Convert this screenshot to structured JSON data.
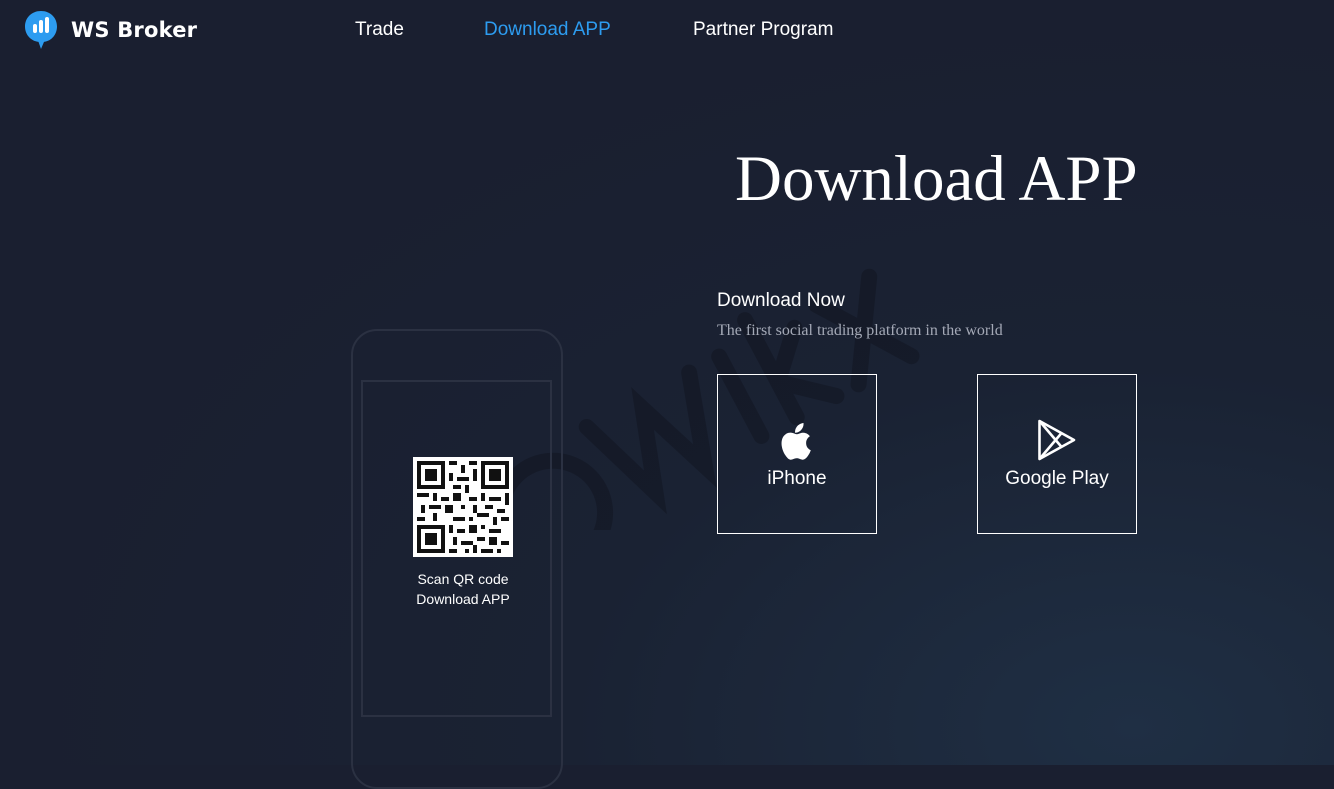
{
  "brand": {
    "name": "WS Broker",
    "icon": "chat-bars-logo-icon",
    "color": "#2d9cf0"
  },
  "nav": {
    "items": [
      {
        "label": "Trade",
        "active": false
      },
      {
        "label": "Download APP",
        "active": true
      },
      {
        "label": "Partner Program",
        "active": false
      }
    ]
  },
  "hero": {
    "title": "Download APP",
    "subtitle": "Download Now",
    "description": "The first social trading platform in the world"
  },
  "downloads": {
    "iphone": {
      "label": "iPhone",
      "icon": "apple-icon"
    },
    "google_play": {
      "label": "Google Play",
      "icon": "google-play-icon"
    }
  },
  "qr": {
    "icon": "qr-code-icon",
    "line1": "Scan QR code",
    "line2": "Download APP"
  },
  "colors": {
    "background": "#1a1f30",
    "accent": "#2d9cf0",
    "muted_text": "#a4a9b6",
    "phone_outline": "#2b3142"
  }
}
